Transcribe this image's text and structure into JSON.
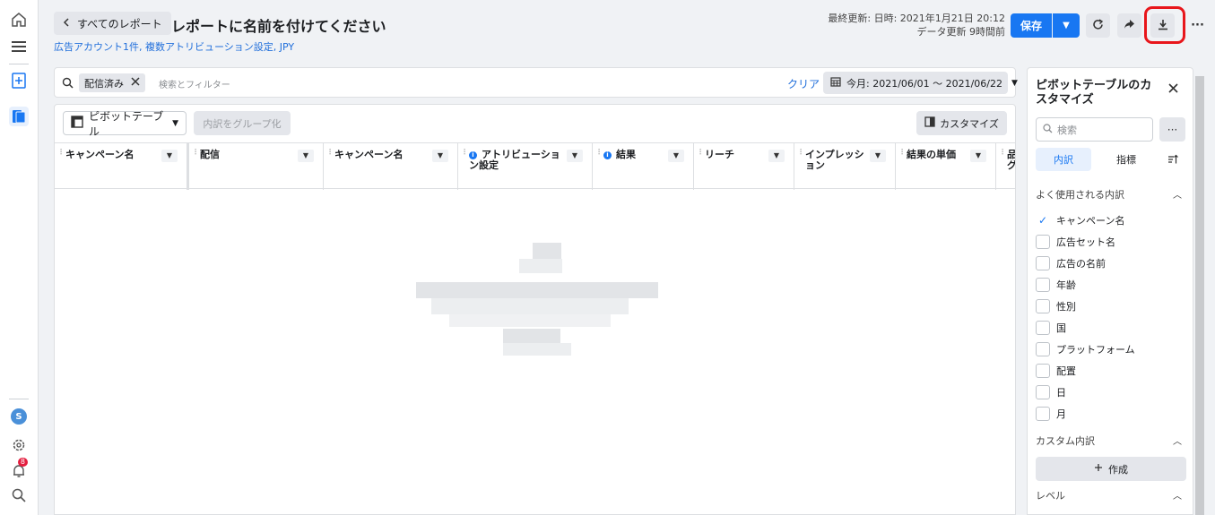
{
  "header": {
    "back_label": "すべてのレポート",
    "title": "レポートに名前を付けてください",
    "subtitle": "広告アカウント1件, 複数アトリビューション設定, JPY",
    "last_updated": "最終更新: 日時: 2021年1月21日 20:12",
    "data_refresh": "データ更新 9時間前",
    "save_label": "保存"
  },
  "rail": {
    "avatar_letter": "S",
    "notifications_count": "8"
  },
  "filter_bar": {
    "chip_label": "配信済み",
    "search_placeholder": "検索とフィルター",
    "clear_label": "クリア",
    "date_range": "今月: 2021/06/01 ～ 2021/06/22"
  },
  "toolbar": {
    "pivot_label": "ピボットテーブル",
    "group_label": "内訳をグループ化",
    "customize_label": "カスタマイズ"
  },
  "table": {
    "columns": [
      {
        "label": "キャンペーン名",
        "info": false
      },
      {
        "label": "配信",
        "info": false
      },
      {
        "label": "キャンペーン名",
        "info": false
      },
      {
        "label": "アトリビューション設定",
        "info": true
      },
      {
        "label": "結果",
        "info": true
      },
      {
        "label": "リーチ",
        "info": false
      },
      {
        "label": "インプレッション",
        "info": false
      },
      {
        "label": "結果の単価",
        "info": false
      },
      {
        "label": "品グ",
        "info": false
      }
    ]
  },
  "panel": {
    "title": "ピボットテーブルのカスタマイズ",
    "search_placeholder": "検索",
    "tabs": [
      "内訳",
      "指標"
    ],
    "section_frequent": "よく使用される内訳",
    "items": [
      {
        "label": "キャンペーン名",
        "checked": true
      },
      {
        "label": "広告セット名",
        "checked": false
      },
      {
        "label": "広告の名前",
        "checked": false
      },
      {
        "label": "年齢",
        "checked": false
      },
      {
        "label": "性別",
        "checked": false
      },
      {
        "label": "国",
        "checked": false
      },
      {
        "label": "プラットフォーム",
        "checked": false
      },
      {
        "label": "配置",
        "checked": false
      },
      {
        "label": "日",
        "checked": false
      },
      {
        "label": "月",
        "checked": false
      }
    ],
    "section_custom": "カスタム内訳",
    "create_label": "作成",
    "section_level": "レベル"
  },
  "colors": {
    "accent": "#1877f2",
    "highlight": "#e8161b"
  },
  "icons": [
    "home-icon",
    "menu-icon",
    "ad-manager-icon",
    "reports-icon",
    "settings-icon",
    "bell-icon",
    "search-icon",
    "refresh-icon",
    "share-icon",
    "download-icon",
    "more-icon",
    "calendar-icon",
    "pivot-table-icon",
    "customize-icon",
    "close-icon",
    "checkmark-icon",
    "sort-icon",
    "plus-icon",
    "chevron-down-icon",
    "chevron-up-icon",
    "chevron-left-icon"
  ]
}
